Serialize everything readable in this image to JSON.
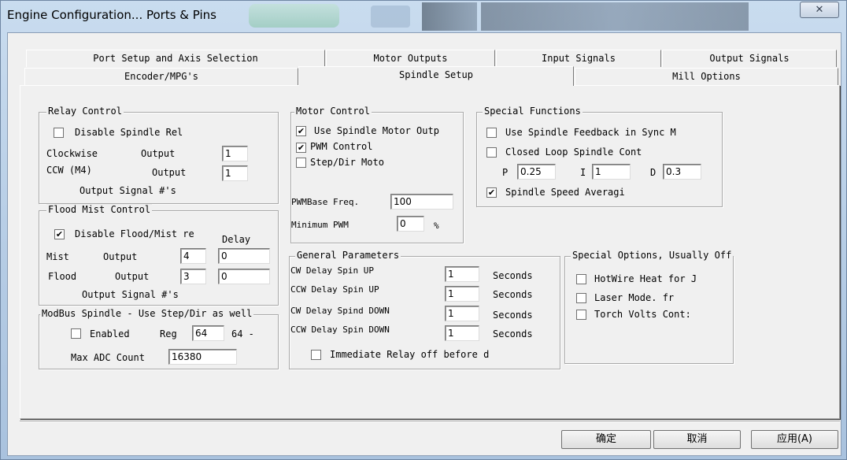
{
  "window": {
    "title": "Engine Configuration... Ports & Pins",
    "close_glyph": "✕"
  },
  "tabs": {
    "row1": [
      "Port Setup and Axis Selection",
      "Motor Outputs",
      "Input Signals",
      "Output Signals"
    ],
    "row2": [
      "Encoder/MPG's",
      "Spindle Setup",
      "Mill Options"
    ],
    "active": "Spindle Setup"
  },
  "relay_control": {
    "title": "Relay Control",
    "disable_label": "Disable Spindle Rel",
    "disable_checked": false,
    "cw_label": "Clockwise",
    "ccw_label": "CCW (M4)",
    "output_label": "Output",
    "cw_output": "1",
    "ccw_output": "1",
    "footer": "Output Signal #'s"
  },
  "flood_mist": {
    "title": "Flood Mist Control",
    "disable_label": "Disable Flood/Mist re",
    "disable_checked": true,
    "delay_label": "Delay",
    "mist_label": "Mist",
    "flood_label": "Flood",
    "output_label": "Output",
    "mist_output": "4",
    "mist_delay": "0",
    "flood_output": "3",
    "flood_delay": "0",
    "footer": "Output Signal #'s"
  },
  "modbus": {
    "title": "ModBus Spindle - Use Step/Dir as well",
    "enabled_label": "Enabled",
    "enabled_checked": false,
    "reg_label": "Reg",
    "reg_value": "64",
    "reg_suffix": "64 -",
    "max_adc_label": "Max ADC Count",
    "max_adc_value": "16380"
  },
  "motor_control": {
    "title": "Motor Control",
    "use_spindle_label": "Use Spindle Motor Outp",
    "use_spindle_checked": true,
    "pwm_label": "PWM Control",
    "pwm_checked": true,
    "stepdir_label": "Step/Dir Moto",
    "stepdir_checked": false,
    "pwm_base_label": "PWMBase Freq.",
    "pwm_base_value": "100",
    "min_pwm_label": "Minimum PWM",
    "min_pwm_value": "0",
    "min_pwm_unit": "%"
  },
  "special_functions": {
    "title": "Special Functions",
    "feedback_label": "Use Spindle Feedback in Sync M",
    "feedback_checked": false,
    "closed_loop_label": "Closed Loop Spindle Cont",
    "closed_loop_checked": false,
    "p_label": "P",
    "p_value": "0.25",
    "i_label": "I",
    "i_value": "1",
    "d_label": "D",
    "d_value": "0.3",
    "averaging_label": "Spindle Speed Averagi",
    "averaging_checked": true
  },
  "general_params": {
    "title": "General Parameters",
    "rows": [
      {
        "label": "CW Delay Spin UP",
        "value": "1",
        "unit": "Seconds"
      },
      {
        "label": "CCW Delay Spin UP",
        "value": "1",
        "unit": "Seconds"
      },
      {
        "label": "CW Delay Spind DOWN",
        "value": "1",
        "unit": "Seconds"
      },
      {
        "label": "CCW Delay Spin DOWN",
        "value": "1",
        "unit": "Seconds"
      }
    ],
    "immediate_label": "Immediate Relay off before d",
    "immediate_checked": false
  },
  "special_options": {
    "title": "Special Options, Usually Off",
    "hotwire_label": "HotWire Heat for J",
    "hotwire_checked": false,
    "laser_label": "Laser Mode. fr",
    "laser_checked": false,
    "torch_label": "Torch Volts Cont:",
    "torch_checked": false
  },
  "buttons": {
    "ok": "确定",
    "cancel": "取消",
    "apply": "应用(A)"
  }
}
